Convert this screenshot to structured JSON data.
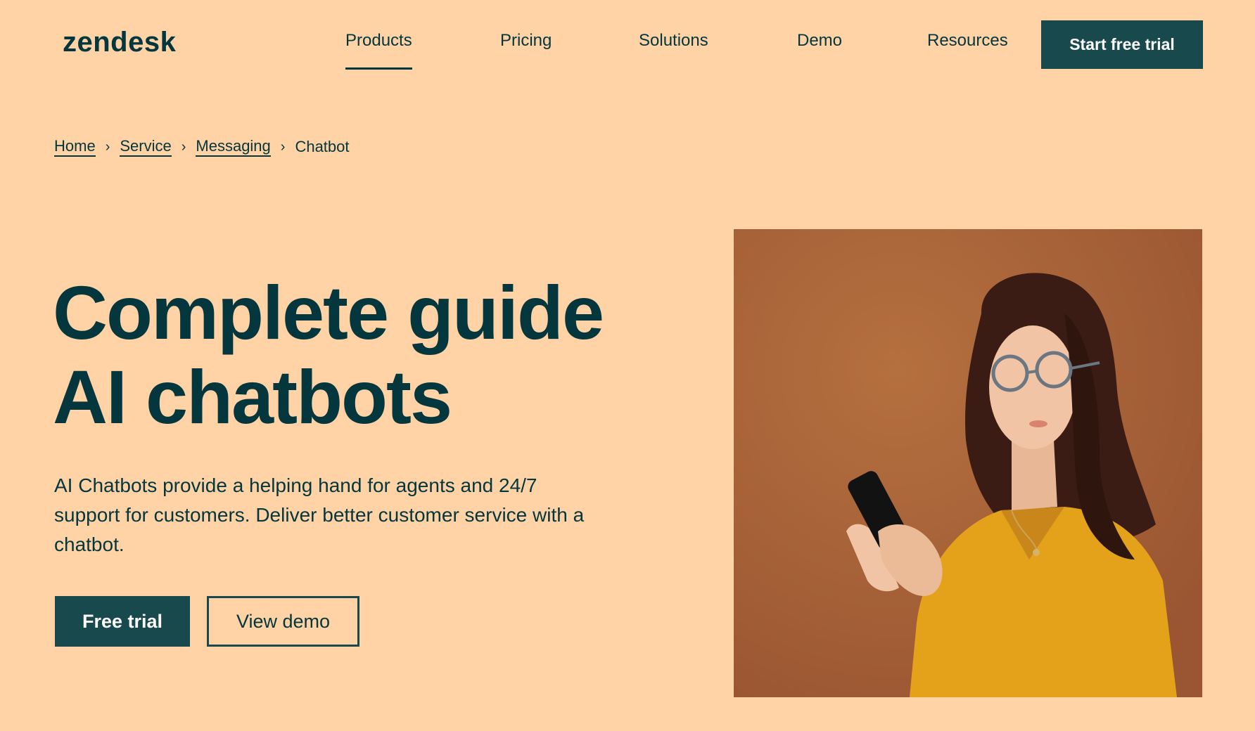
{
  "header": {
    "logo": "zendesk",
    "nav": [
      {
        "label": "Products",
        "active": true
      },
      {
        "label": "Pricing"
      },
      {
        "label": "Solutions"
      },
      {
        "label": "Demo"
      },
      {
        "label": "Resources"
      }
    ],
    "cta_label": "Start free trial"
  },
  "breadcrumb": {
    "items": [
      "Home",
      "Service",
      "Messaging"
    ],
    "current": "Chatbot",
    "separator": "›"
  },
  "hero": {
    "title_line1": "Complete guide",
    "title_line2": "AI chatbots",
    "description": "AI Chatbots provide a helping hand for agents and 24/7 support for customers. Deliver better customer service with a chatbot.",
    "primary_button": "Free trial",
    "secondary_button": "View demo",
    "image": "woman-with-phone-photo"
  },
  "colors": {
    "background": "#FFD3A5",
    "text": "#03363D",
    "button": "#17494D",
    "photo_bg": "#A8613A",
    "shirt": "#E8A21C"
  }
}
